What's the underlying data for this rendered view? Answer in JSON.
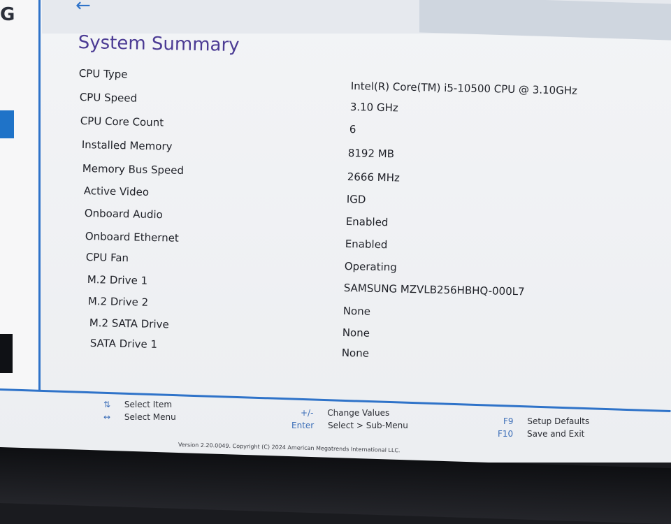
{
  "header": {
    "back_icon": "arrow-left-icon",
    "title": "System Summary"
  },
  "summary": [
    {
      "label": "CPU Type",
      "value": "Intel(R) Core(TM) i5-10500 CPU @ 3.10GHz"
    },
    {
      "label": "CPU Speed",
      "value": "3.10 GHz"
    },
    {
      "label": "CPU Core Count",
      "value": "6"
    },
    {
      "label": "Installed Memory",
      "value": "8192 MB"
    },
    {
      "label": "Memory Bus Speed",
      "value": "2666 MHz"
    },
    {
      "label": "Active Video",
      "value": "IGD"
    },
    {
      "label": "Onboard Audio",
      "value": "Enabled"
    },
    {
      "label": "Onboard Ethernet",
      "value": "Enabled"
    },
    {
      "label": "CPU Fan",
      "value": "Operating"
    },
    {
      "label": "M.2 Drive 1",
      "value": "SAMSUNG MZVLB256HBHQ-000L7"
    },
    {
      "label": "M.2 Drive 2",
      "value": "None"
    },
    {
      "label": "M.2 SATA Drive",
      "value": "None"
    },
    {
      "label": "SATA Drive 1",
      "value": "None"
    }
  ],
  "footer": {
    "hints": [
      {
        "key": "⇅",
        "desc": "Select Item"
      },
      {
        "key": "↔",
        "desc": "Select Menu"
      },
      {
        "key": "+/-",
        "desc": "Change Values"
      },
      {
        "key": "Enter",
        "desc": "Select > Sub-Menu"
      },
      {
        "key": "F9",
        "desc": "Setup Defaults"
      },
      {
        "key": "F10",
        "desc": "Save and Exit"
      }
    ],
    "copyright": "Version 2.20.0049. Copyright (C) 2024 American Megatrends International LLC."
  },
  "colors": {
    "accent": "#2f73c9",
    "title": "#4b3b94",
    "background": "#f0f1f3"
  }
}
